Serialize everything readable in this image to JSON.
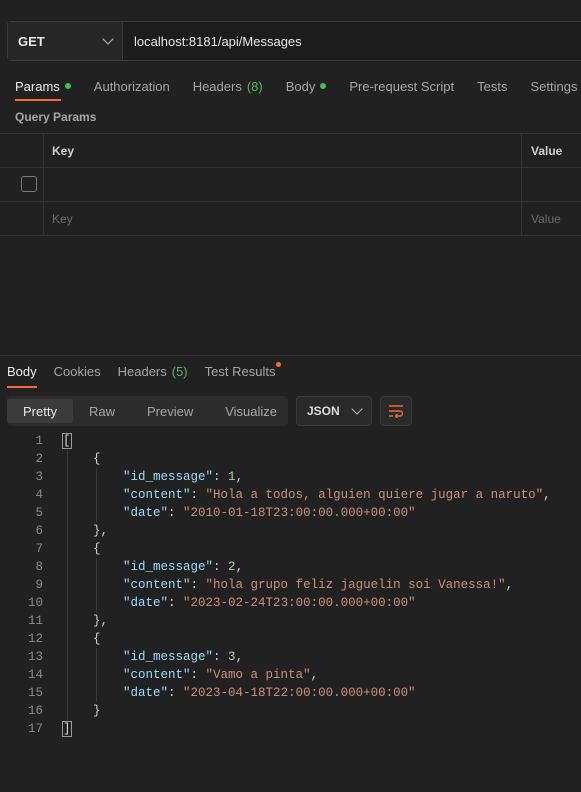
{
  "request": {
    "method": "GET",
    "url": "localhost:8181/api/Messages",
    "tabs": [
      {
        "label": "Params",
        "dot": true
      },
      {
        "label": "Authorization"
      },
      {
        "label": "Headers",
        "count": "(8)"
      },
      {
        "label": "Body",
        "dot": true
      },
      {
        "label": "Pre-request Script"
      },
      {
        "label": "Tests"
      },
      {
        "label": "Settings"
      }
    ],
    "query_params_label": "Query Params",
    "table": {
      "col_key": "Key",
      "col_value": "Value",
      "placeholder_key": "Key",
      "placeholder_value": "Value"
    }
  },
  "response": {
    "tabs": [
      {
        "label": "Body"
      },
      {
        "label": "Cookies"
      },
      {
        "label": "Headers",
        "count": "(5)"
      },
      {
        "label": "Test Results"
      }
    ],
    "views": [
      "Pretty",
      "Raw",
      "Preview",
      "Visualize"
    ],
    "format": "JSON",
    "code_lines": [
      "1",
      "2",
      "3",
      "4",
      "5",
      "6",
      "7",
      "8",
      "9",
      "10",
      "11",
      "12",
      "13",
      "14",
      "15",
      "16",
      "17"
    ],
    "messages": [
      {
        "id_message": "1",
        "content": "\"Hola a todos, alguien quiere jugar a naruto\"",
        "date": "\"2010-01-18T23:00:00.000+00:00\""
      },
      {
        "id_message": "2",
        "content": "\"hola grupo feliz jaguelin soi Vanessa!\"",
        "date": "\"2023-02-24T23:00:00.000+00:00\""
      },
      {
        "id_message": "3",
        "content": "\"Vamo a pinta\"",
        "date": "\"2023-04-18T22:00:00.000+00:00\""
      }
    ]
  },
  "colors": {
    "accent": "#f26b3a",
    "green": "#3dbf5a",
    "json_key": "#9cdcfe",
    "json_string": "#ce9178",
    "json_number": "#b5cea8"
  }
}
